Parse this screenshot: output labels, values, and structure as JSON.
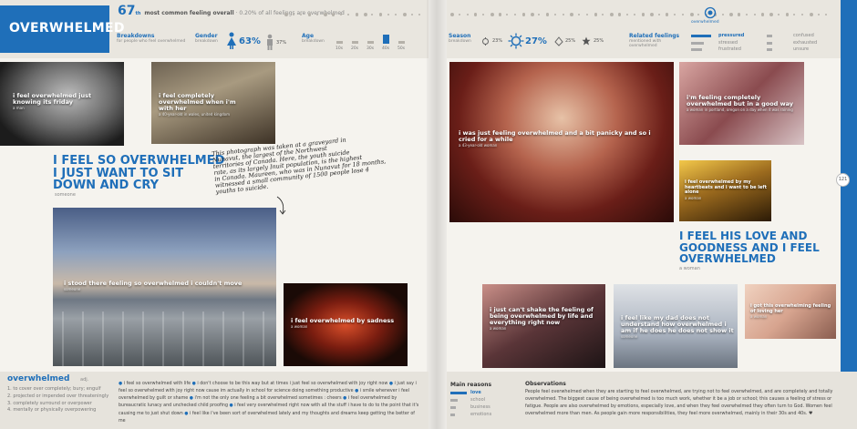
{
  "header": {
    "title": "OVERWHELMED",
    "rank_number": "67",
    "rank_suffix": "th",
    "rank_text": "most common feeling overall",
    "rank_detail": "· 0.20% of all feelings are overwhelmed",
    "breakdowns_label": "Breakdowns",
    "breakdowns_sub": "for people who feel overwhelmed",
    "gender_label": "Gender",
    "gender_sub": "breakdown",
    "gender_female_pct": "63%",
    "gender_male_pct": "37%",
    "age_label": "Age",
    "age_sub": "breakdown",
    "age_groups": [
      "10s",
      "20s",
      "30s",
      "40s",
      "50s"
    ],
    "age_values": [
      0.35,
      0.35,
      0.35,
      1.0,
      0.35
    ],
    "season_label": "Season",
    "season_sub": "breakdown",
    "season_pcts": [
      "23%",
      "27%",
      "25%",
      "25%"
    ],
    "related_label": "Related feelings",
    "related_sub": "mentioned with overwhelmed",
    "related_col1": [
      "pressured",
      "stressed",
      "frustrated"
    ],
    "related_col2": [
      "confused",
      "exhausted",
      "unsure"
    ],
    "marker_label": "overwhelmed",
    "accent_color": "#1f6fb9"
  },
  "photos": {
    "p1_text": "i feel overwhelmed just knowing its friday",
    "p1_sub": "a man",
    "p2_text": "i feel completely overwhelmed when i'm with her",
    "p2_sub": "a 40-year-old in wales, united kingdom",
    "p3_text": "i stood there feeling so overwhelmed i couldn't move",
    "p3_sub": "someone",
    "p4_text": "i feel overwhelmed by sadness",
    "p4_sub": "a woman",
    "p5_text": "i was just feeling overwhelmed and a bit panicky and so i cried for a while",
    "p5_sub": "a 43-year-old woman",
    "p6_text": "i'm feeling completely overwhelmed but in a good way",
    "p6_sub": "a woman in portland, oregon on a day when it was raining",
    "p7_text": "i feel overwhelmed by my heartbeats and i want to be left alone",
    "p7_sub": "a woman",
    "p8_text": "i just can't shake the feeling of being overwhelmed by life and everything right now",
    "p8_sub": "a woman",
    "p9_text": "i feel like my dad does not understand how overwhelmed i am if he does he does not show it",
    "p9_sub": "someone",
    "p10_text": "i got this overwhelming feeling of loving her",
    "p10_sub": "a woman"
  },
  "quote1": {
    "lines": [
      "I FEEL SO OVERWHELMED",
      "I JUST WANT TO SIT",
      "DOWN AND CRY"
    ],
    "sub": "someone"
  },
  "quote2": {
    "lines": [
      "I FEEL HIS LOVE AND",
      "GOODNESS AND I FEEL",
      "OVERWHELMED"
    ],
    "sub": "a woman"
  },
  "handwriting": {
    "lines": [
      "This photograph was taken at a graveyard in",
      "Nunavut, the largest of the Northwest",
      "territories of Canada. Here, the youth suicide",
      "rate, as its largely Inuit population, is the highest",
      "in Canada. Maureen, who was in Nunavut for 18 months,",
      "witnessed a small community of 1500 people lose 4",
      "youths to suicide."
    ]
  },
  "footer_left": {
    "word": "overwhelmed",
    "pos": "adj.",
    "defs": [
      "1. to cover over completely; bury; engulf",
      "2. projected or impended over threateningly",
      "3. completely surround or overpower",
      "4. mentally or physically overpowering"
    ],
    "sentences": [
      "i feel so overwhelmed with life",
      "i don't choose to be this way but at times i just feel so overwhelmed with joy right now",
      "i just say i feel so overwhelmed with joy right now cause im actually in school for science doing something productive",
      "i smile whenever i feel overwhelmed by guilt or shame",
      "i'm not the only one feeling a bit overwhelmed sometimes : cheers",
      "i feel overwhelmed by bureaucratic lunacy and unchecked child proofing",
      "i feel very overwhelmed right now with all the stuff i have to do to the point that it's causing me to just shut down",
      "i feel like i've been sort of overwhelmed lately and my thoughts and dreams keep getting the better of me"
    ]
  },
  "footer_right": {
    "reasons_title": "Main reasons",
    "reasons": [
      "love",
      "school",
      "business",
      "emotions"
    ],
    "reason_values": [
      1.0,
      0.45,
      0.3,
      0.25
    ],
    "obs_title": "Observations",
    "obs_text": "People feel overwhelmed when they are starting to feel overwhelmed, are trying not to feel overwhelmed, and are completely and totally overwhelmed. The biggest cause of being overwhelmed is too much work, whether it be a job or school; this causes a feeling of stress or fatigue. People are also overwhelmed by emotions, especially love, and when they feel overwhelmed they often turn to God. Women feel overwhelmed more than men. As people gain more responsibilities, they feel more overwhelmed, mainly in their 30s and 40s. ♥"
  },
  "page_number": "121"
}
